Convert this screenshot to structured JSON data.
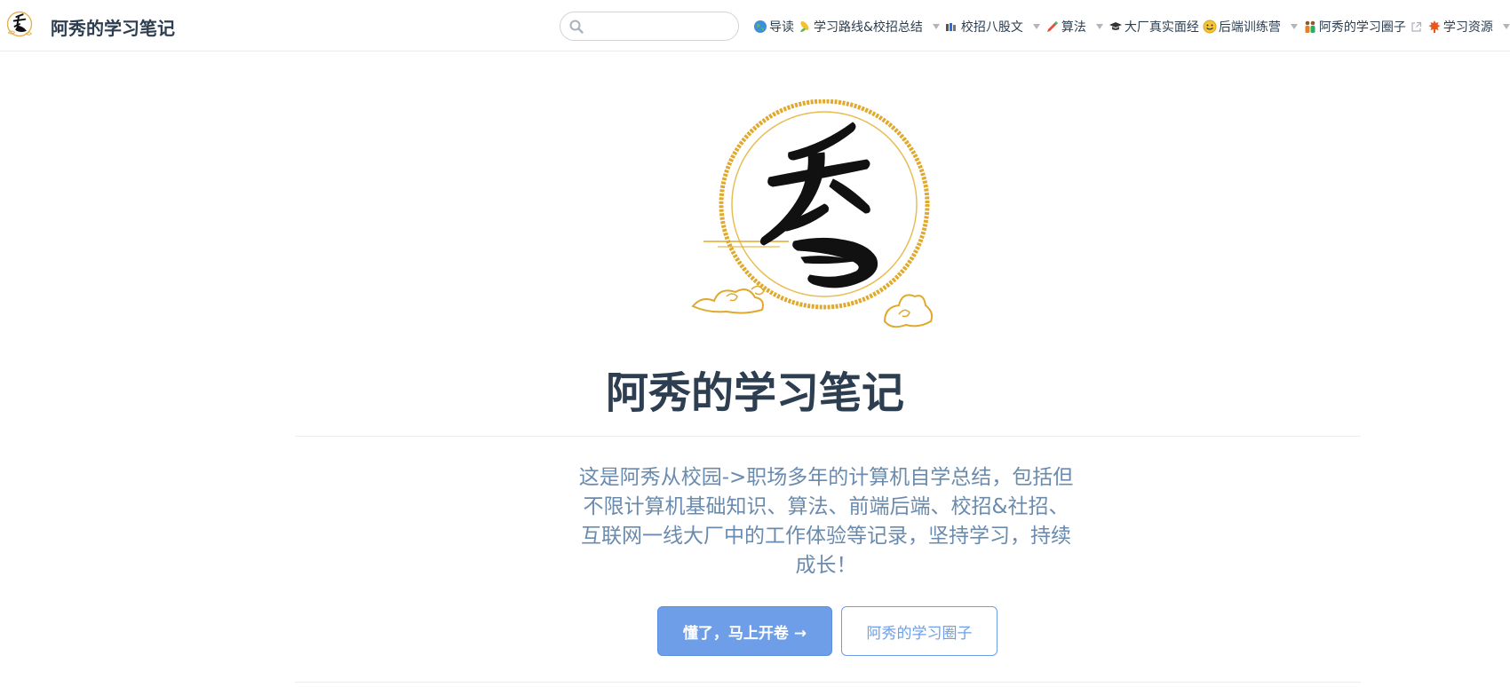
{
  "navbar": {
    "site_name": "阿秀的学习笔记",
    "search": {
      "value": "",
      "placeholder": ""
    },
    "items": [
      {
        "icon": "globe-icon",
        "label": "导读",
        "has_dropdown": false,
        "external": false
      },
      {
        "icon": "corn-icon",
        "label": "学习路线&校招总结",
        "has_dropdown": true,
        "external": false
      },
      {
        "icon": "books-icon",
        "label": "校招八股文",
        "has_dropdown": true,
        "external": false
      },
      {
        "icon": "pen-icon",
        "label": "算法",
        "has_dropdown": true,
        "external": false
      },
      {
        "icon": "grad-cap-icon",
        "label": "大厂真实面经",
        "has_dropdown": false,
        "external": false
      },
      {
        "icon": "smile-icon",
        "label": "后端训练营",
        "has_dropdown": true,
        "external": false
      },
      {
        "icon": "people-icon",
        "label": "阿秀的学习圈子",
        "has_dropdown": false,
        "external": true
      },
      {
        "icon": "maple-leaf-icon",
        "label": "学习资源",
        "has_dropdown": true,
        "external": false
      }
    ]
  },
  "hero": {
    "logo_icon": "xiu-calligraphy-logo",
    "title": "阿秀的学习笔记",
    "description": "这是阿秀从校园->职场多年的计算机自学总结，包括但不限计算机基础知识、算法、前端后端、校招&社招、互联网一线大厂中的工作体验等记录，坚持学习，持续成长！",
    "primary_button": "懂了，马上开卷 →",
    "secondary_button": "阿秀的学习圈子"
  },
  "colors": {
    "accent": "#6e9ee8",
    "text": "#2c3e50",
    "desc": "#6a8bad",
    "gold": "#d9a520"
  }
}
